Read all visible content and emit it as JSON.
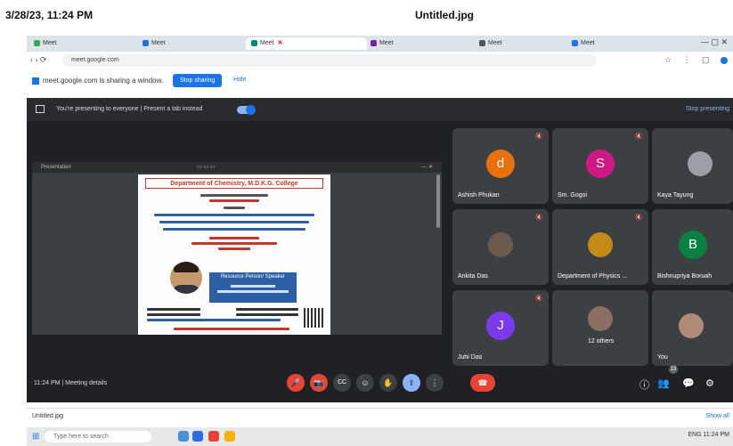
{
  "photo_caption": {
    "timestamp": "3/28/23, 11:24 PM",
    "filename": "Untitled.jpg"
  },
  "browser": {
    "tabs": [
      "Meet",
      "Meet",
      "Meet",
      "Meet",
      "Meet",
      "Meet"
    ],
    "active_tab_close": "✕",
    "nav_glyphs": "‹ › ⟳",
    "url": "meet.google.com",
    "toolbar_glyphs": "☆ ⋮ ▢"
  },
  "share_bar": {
    "text": "meet.google.com is sharing a window.",
    "stop_label": "Stop sharing",
    "hide_label": "Hide"
  },
  "meet": {
    "presenting_text": "You're presenting to everyone  |  Present a tab instead",
    "stop_presenting": "Stop presenting",
    "presentation": {
      "window_title": "Presentation",
      "poster_heading": "Department of Chemistry, M.D.K.G. College",
      "speaker_box_line1": "Resource Person/ Speaker",
      "speaker_box_line2": "",
      "speaker_box_line3": ""
    },
    "participants": [
      {
        "name": "Ashish Phukan",
        "initial": "d",
        "color": "#e8710a",
        "kind": "letter"
      },
      {
        "name": "Sm. Gogoi",
        "initial": "S",
        "color": "#d01884",
        "kind": "letter"
      },
      {
        "name": "Kaya Tayung",
        "initial": "",
        "color": "#9aa0a6",
        "kind": "image"
      },
      {
        "name": "Ankita Das",
        "initial": "",
        "color": "#6b5a4e",
        "kind": "image"
      },
      {
        "name": "Department of Physics ...",
        "initial": "",
        "color": "#c58a16",
        "kind": "image"
      },
      {
        "name": "Bishnupriya Boruah",
        "initial": "B",
        "color": "#0b8043",
        "kind": "letter"
      },
      {
        "name": "Juhi Das",
        "initial": "J",
        "color": "#7c3aed",
        "kind": "letter"
      },
      {
        "name": "12 others",
        "initial": "",
        "color": "#8d6e63",
        "kind": "image"
      },
      {
        "name": "You",
        "initial": "",
        "color": "#b08a78",
        "kind": "image"
      }
    ],
    "meeting_info": "11:24 PM  |  Meeting details",
    "participant_badge": "13",
    "controls": {
      "mic": "🎤",
      "cam": "📷",
      "cc": "CC",
      "emoji": "☺",
      "present": "⇪",
      "raise": "✋",
      "more": "⋮",
      "end": "☎"
    },
    "right_controls": {
      "info": "ⓘ",
      "people": "👥",
      "chat": "💬",
      "activities": "⚙"
    }
  },
  "downloads": {
    "item": "Untitled.jpg",
    "show_all": "Show all"
  },
  "taskbar": {
    "start": "⊞",
    "search_placeholder": "Type here to search",
    "tray": "ENG  11:24 PM"
  }
}
